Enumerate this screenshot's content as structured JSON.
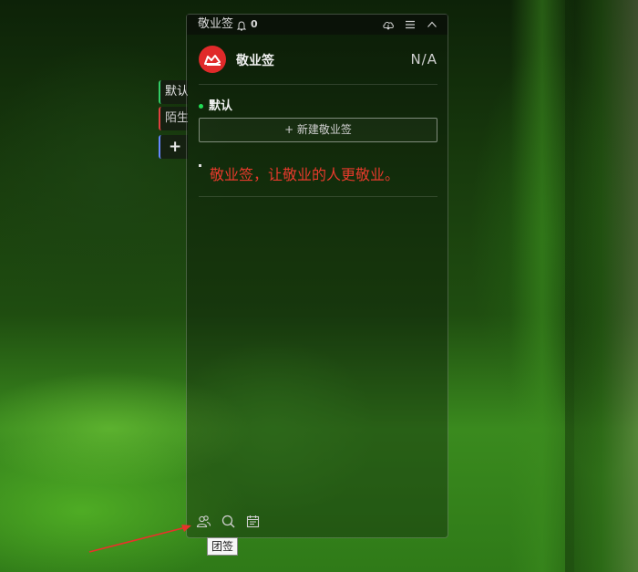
{
  "side_tabs": [
    {
      "label": "默认",
      "accent": "#33cc66"
    },
    {
      "label": "陌生",
      "accent": "#e04040"
    },
    {
      "label": "+",
      "accent": "#6688ff"
    }
  ],
  "titlebar": {
    "title": "敬业签",
    "notification_count": "0",
    "icons": [
      "cloud-sync-icon",
      "menu-icon",
      "collapse-icon"
    ]
  },
  "header": {
    "app_name": "敬业签",
    "status": "N/A",
    "logo_color": "#e02a2a"
  },
  "category": {
    "name": "默认",
    "dot_color": "#22dd55"
  },
  "new_button_label": "+ 新建敬业签",
  "notes": [
    {
      "text": "敬业签，让敬业的人更敬业。",
      "color": "#e83a2c"
    }
  ],
  "bottom_bar": {
    "icons": [
      "team-note-icon",
      "search-icon",
      "calendar-icon"
    ],
    "tooltip": "团签"
  }
}
